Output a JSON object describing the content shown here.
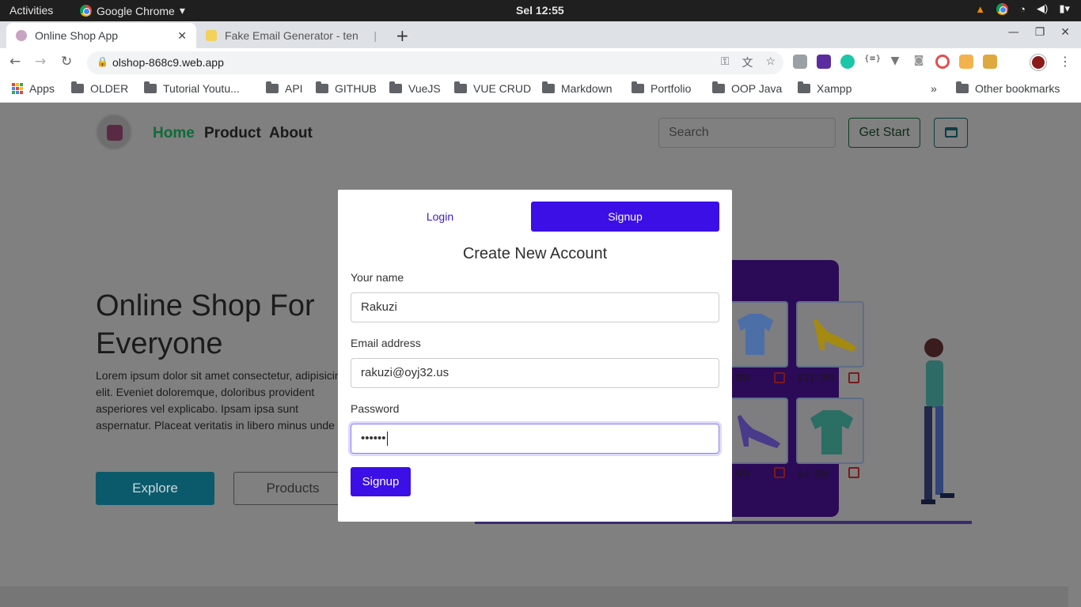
{
  "system": {
    "activities": "Activities",
    "app_name": "Google Chrome",
    "clock": "Sel 12:55"
  },
  "browser": {
    "tabs": [
      {
        "title": "Online Shop App"
      },
      {
        "title": "Fake Email Generator - ten"
      }
    ],
    "url": "olshop-868c9.web.app",
    "bookmarks": [
      "Apps",
      "OLDER",
      "Tutorial Youtu...",
      "API",
      "GITHUB",
      "VueJS",
      "VUE CRUD",
      "Markdown",
      "Portfolio",
      "OOP Java",
      "Xampp"
    ],
    "more_bookmarks": "»",
    "other_bookmarks": "Other bookmarks"
  },
  "site": {
    "nav": [
      {
        "label": "Home",
        "color": "#0f6b38"
      },
      {
        "label": "Product",
        "color": "#1a1a1a"
      },
      {
        "label": "About",
        "color": "#1a1a1a"
      }
    ],
    "search_placeholder": "Search",
    "get_start": "Get Start",
    "hero_title": "Online Shop For Everyone",
    "hero_text": "Lorem ipsum dolor sit amet consectetur, adipisicing elit. Eveniet doloremque, doloribus provident asperiores vel explicabo. Ipsam ipsa sunt aspernatur. Placeat veritatis in libero minus unde ab repellendus iste non!",
    "explore": "Explore",
    "products": "Products",
    "illustration_prices": [
      "$.99",
      "$10.99",
      "$.99",
      "$4.99"
    ]
  },
  "modal": {
    "tab_login": "Login",
    "tab_signup": "Signup",
    "title": "Create New Account",
    "name_label": "Your name",
    "name_value": "Rakuzi",
    "email_label": "Email address",
    "email_value": "rakuzi@oyj32.us",
    "password_label": "Password",
    "password_value": "••••••",
    "submit": "Signup"
  },
  "colors": {
    "accent": "#3b0fe6",
    "overlay": "#808080"
  }
}
